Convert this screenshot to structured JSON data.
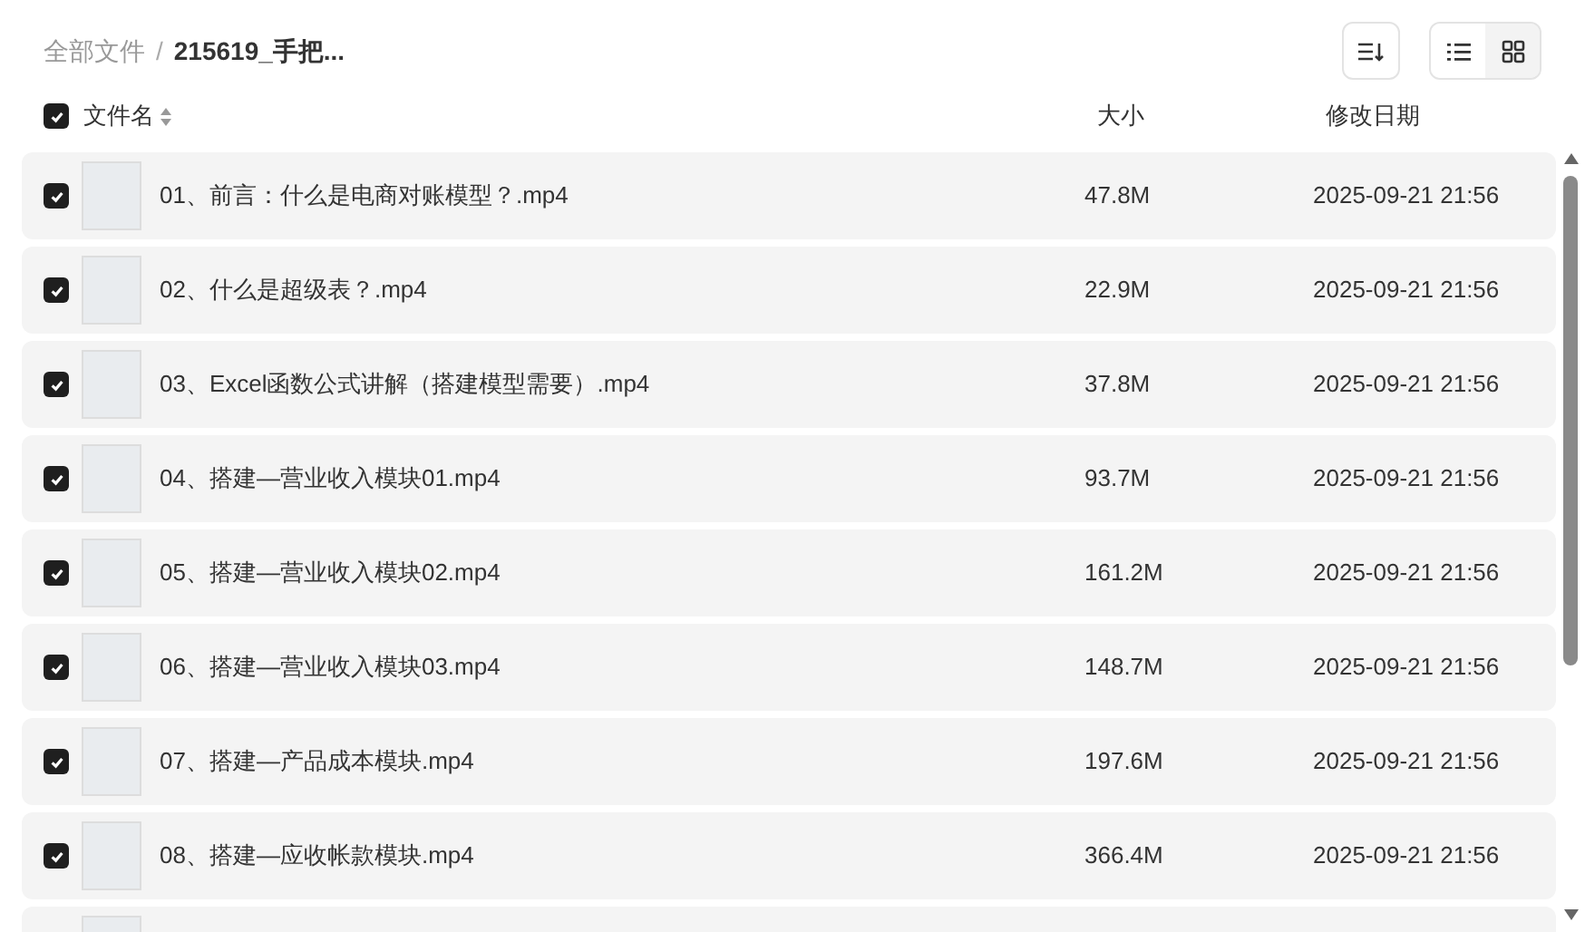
{
  "breadcrumb": [
    {
      "label": "全部文件"
    },
    {
      "label": "215619_手把..."
    }
  ],
  "breadcrumb_separator": "/",
  "view_modes": [
    {
      "kind": "list",
      "selected": true
    },
    {
      "kind": "grid",
      "selected": false
    }
  ],
  "table": {
    "select_all": {
      "checked": true
    },
    "columns": [
      "文件名",
      "大小",
      "修改日期"
    ],
    "rows": [
      {
        "checked": true,
        "name": "01、前言：什么是电商对账模型？.mp4",
        "size": "47.8M",
        "modified": "2025-09-21 21:56"
      },
      {
        "checked": true,
        "name": "02、什么是超级表？.mp4",
        "size": "22.9M",
        "modified": "2025-09-21 21:56"
      },
      {
        "checked": true,
        "name": "03、Excel函数公式讲解（搭建模型需要）.mp4",
        "size": "37.8M",
        "modified": "2025-09-21 21:56"
      },
      {
        "checked": true,
        "name": "04、搭建—营业收入模块01.mp4",
        "size": "93.7M",
        "modified": "2025-09-21 21:56"
      },
      {
        "checked": true,
        "name": "05、搭建—营业收入模块02.mp4",
        "size": "161.2M",
        "modified": "2025-09-21 21:56"
      },
      {
        "checked": true,
        "name": "06、搭建—营业收入模块03.mp4",
        "size": "148.7M",
        "modified": "2025-09-21 21:56"
      },
      {
        "checked": true,
        "name": "07、搭建—产品成本模块.mp4",
        "size": "197.6M",
        "modified": "2025-09-21 21:56"
      },
      {
        "checked": true,
        "name": "08、搭建—应收帐款模块.mp4",
        "size": "366.4M",
        "modified": "2025-09-21 21:56"
      },
      {}
    ]
  }
}
